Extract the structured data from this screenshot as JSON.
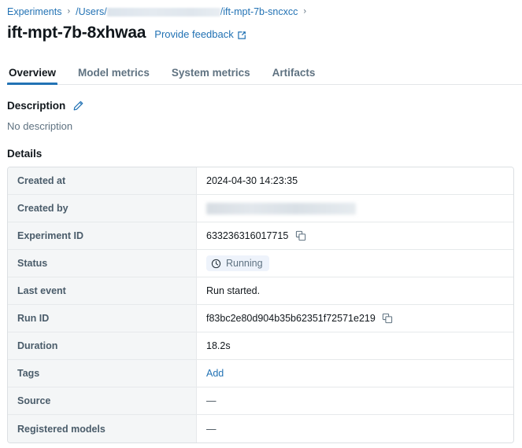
{
  "breadcrumb": {
    "items": [
      {
        "label": "Experiments",
        "type": "link"
      },
      {
        "label": "/Users/",
        "type": "link-prefix"
      },
      {
        "label": "/ift-mpt-7b-sncxcc",
        "type": "link-suffix"
      }
    ],
    "separator": "›",
    "redacted": true
  },
  "header": {
    "title": "ift-mpt-7b-8xhwaa",
    "feedback_label": "Provide feedback",
    "feedback_icon": "external-link-icon"
  },
  "tabs": [
    {
      "label": "Overview",
      "active": true
    },
    {
      "label": "Model metrics",
      "active": false
    },
    {
      "label": "System metrics",
      "active": false
    },
    {
      "label": "Artifacts",
      "active": false
    }
  ],
  "description": {
    "heading": "Description",
    "edit_icon": "pencil-icon",
    "body": "No description"
  },
  "details": {
    "heading": "Details",
    "rows": [
      {
        "label": "Created at",
        "value": "2024-04-30 14:23:35",
        "kind": "text"
      },
      {
        "label": "Created by",
        "value": "",
        "kind": "redacted"
      },
      {
        "label": "Experiment ID",
        "value": "633236316017715",
        "kind": "copyable"
      },
      {
        "label": "Status",
        "value": "Running",
        "kind": "badge"
      },
      {
        "label": "Last event",
        "value": "Run started.",
        "kind": "text"
      },
      {
        "label": "Run ID",
        "value": "f83bc2e80d904b35b62351f72571e219",
        "kind": "copyable"
      },
      {
        "label": "Duration",
        "value": "18.2s",
        "kind": "text"
      },
      {
        "label": "Tags",
        "value": "Add",
        "kind": "link"
      },
      {
        "label": "Source",
        "value": "—",
        "kind": "dash"
      },
      {
        "label": "Registered models",
        "value": "—",
        "kind": "dash"
      }
    ],
    "copy_icon": "copy-icon",
    "status_icon": "clock-icon"
  },
  "colors": {
    "accent_blue": "#2272b4",
    "text_primary": "#11171c",
    "text_secondary": "#5f7281",
    "label_bg": "#f4f6f7",
    "border": "#dce0e3",
    "badge_bg": "#eef3fb"
  }
}
